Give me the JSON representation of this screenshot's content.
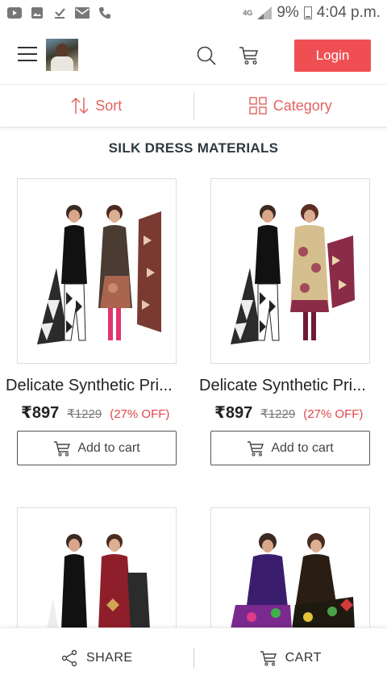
{
  "status_bar": {
    "network": "4G",
    "battery": "9%",
    "time": "4:04 p.m.",
    "icons": [
      "youtube-icon",
      "gallery-icon",
      "download-done-icon",
      "email-icon",
      "phone-icon"
    ]
  },
  "header": {
    "login_label": "Login",
    "accent_color": "#ef4f53"
  },
  "filter_bar": {
    "sort_label": "Sort",
    "category_label": "Category"
  },
  "section_title": "SILK DRESS MATERIALS",
  "products": [
    {
      "title": "Delicate Synthetic Pri...",
      "price": "₹897",
      "mrp": "₹1229",
      "discount": "(27% OFF)",
      "button": "Add to cart"
    },
    {
      "title": "Delicate Synthetic Pri...",
      "price": "₹897",
      "mrp": "₹1229",
      "discount": "(27% OFF)",
      "button": "Add to cart"
    }
  ],
  "bottom_bar": {
    "share_label": "SHARE",
    "cart_label": "CART"
  }
}
